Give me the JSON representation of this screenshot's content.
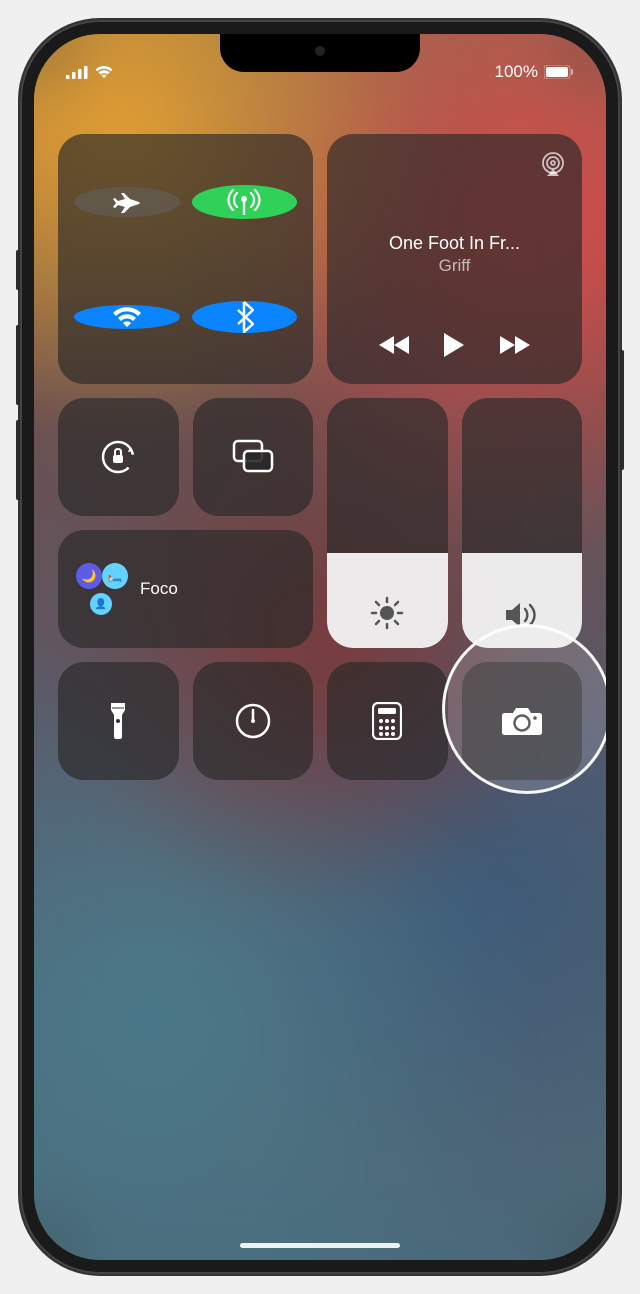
{
  "status": {
    "battery_text": "100%",
    "signal_bars": 4,
    "wifi_bars": 3
  },
  "connectivity": {
    "airplane_active": false,
    "cellular_active": true,
    "wifi_active": true,
    "bluetooth_active": true
  },
  "media": {
    "title": "One Foot In Fr...",
    "artist": "Griff"
  },
  "sliders": {
    "brightness_fill": 38,
    "volume_fill": 38
  },
  "focus": {
    "label": "Foco"
  },
  "colors": {
    "green": "#30d158",
    "blue": "#0a84ff",
    "indigo": "#5e5ce6",
    "teal": "#64d2ff"
  }
}
